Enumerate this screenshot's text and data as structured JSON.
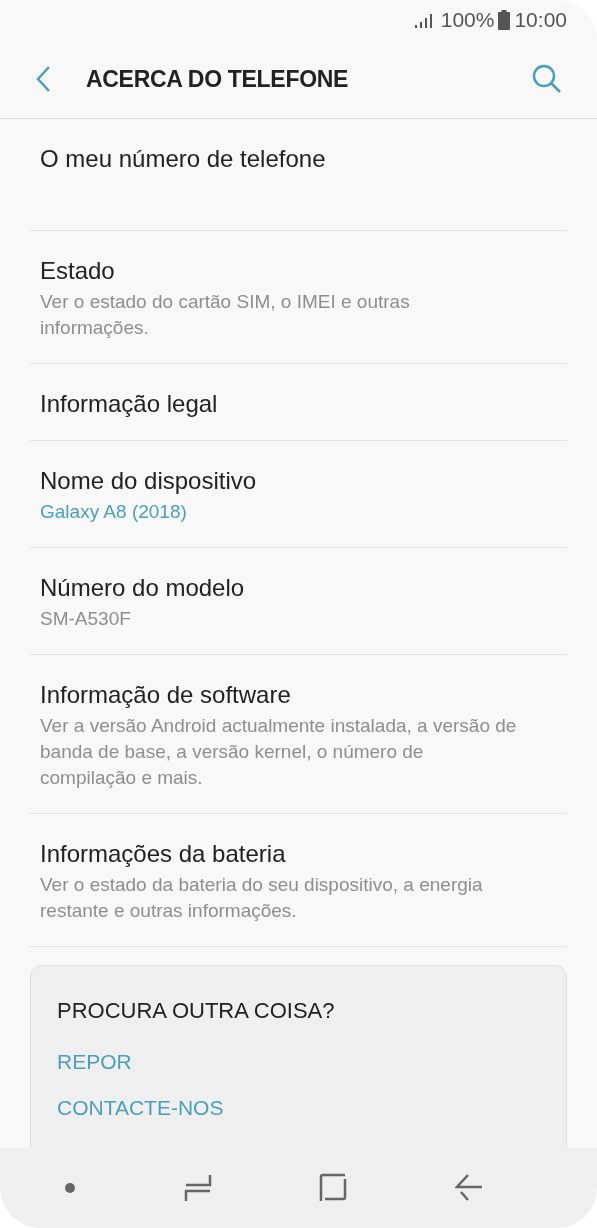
{
  "status_bar": {
    "battery": "100%",
    "time": "10:00"
  },
  "header": {
    "title": "ACERCA DO TELEFONE"
  },
  "items": [
    {
      "title": "O meu número de telefone",
      "tall": true
    },
    {
      "title": "Estado",
      "subtitle": "Ver o estado do cartão SIM, o IMEI e outras informações.",
      "kind": "plain"
    },
    {
      "title": "Informação legal"
    },
    {
      "title": "Nome do dispositivo",
      "subtitle": "Galaxy A8 (2018)",
      "kind": "accent"
    },
    {
      "title": "Número do modelo",
      "subtitle": "SM-A530F",
      "kind": "plain"
    },
    {
      "title": "Informação de software",
      "subtitle": "Ver a versão Android actualmente instalada, a versão de banda de base, a versão kernel, o número de compilação e mais.",
      "kind": "plain"
    },
    {
      "title": "Informações da bateria",
      "subtitle": "Ver o estado da bateria do seu dispositivo, a energia restante e outras informações.",
      "kind": "plain"
    }
  ],
  "suggestions": {
    "title": "PROCURA OUTRA COISA?",
    "links": [
      "REPOR",
      "CONTACTE-NOS"
    ]
  }
}
